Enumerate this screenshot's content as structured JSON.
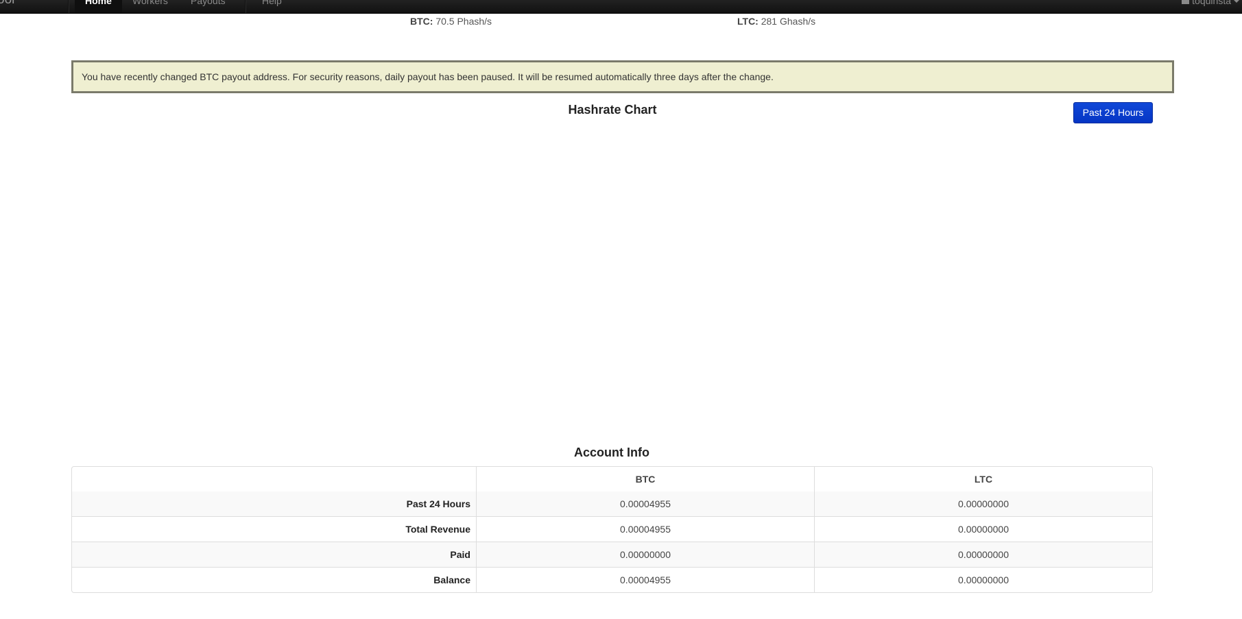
{
  "navbar": {
    "brand": "ool",
    "items": [
      {
        "label": "Home",
        "active": true
      },
      {
        "label": "Workers",
        "active": false
      },
      {
        "label": "Payouts",
        "active": false
      },
      {
        "label": "Help",
        "active": false
      }
    ],
    "user": "toquinsta"
  },
  "hashrate": {
    "btc_label": "BTC:",
    "btc_value": "70.5 Phash/s",
    "ltc_label": "LTC:",
    "ltc_value": "281 Ghash/s"
  },
  "alert": {
    "message": "You have recently changed BTC payout address. For security reasons, daily payout has been paused. It will be resumed automatically three days after the change."
  },
  "chart": {
    "title": "Hashrate Chart",
    "range_button": "Past 24 Hours"
  },
  "account": {
    "title": "Account Info",
    "columns": [
      "",
      "BTC",
      "LTC"
    ],
    "rows": [
      {
        "label": "Past 24 Hours",
        "btc": "0.00004955",
        "ltc": "0.00000000"
      },
      {
        "label": "Total Revenue",
        "btc": "0.00004955",
        "ltc": "0.00000000"
      },
      {
        "label": "Paid",
        "btc": "0.00000000",
        "ltc": "0.00000000"
      },
      {
        "label": "Balance",
        "btc": "0.00004955",
        "ltc": "0.00000000"
      }
    ]
  }
}
